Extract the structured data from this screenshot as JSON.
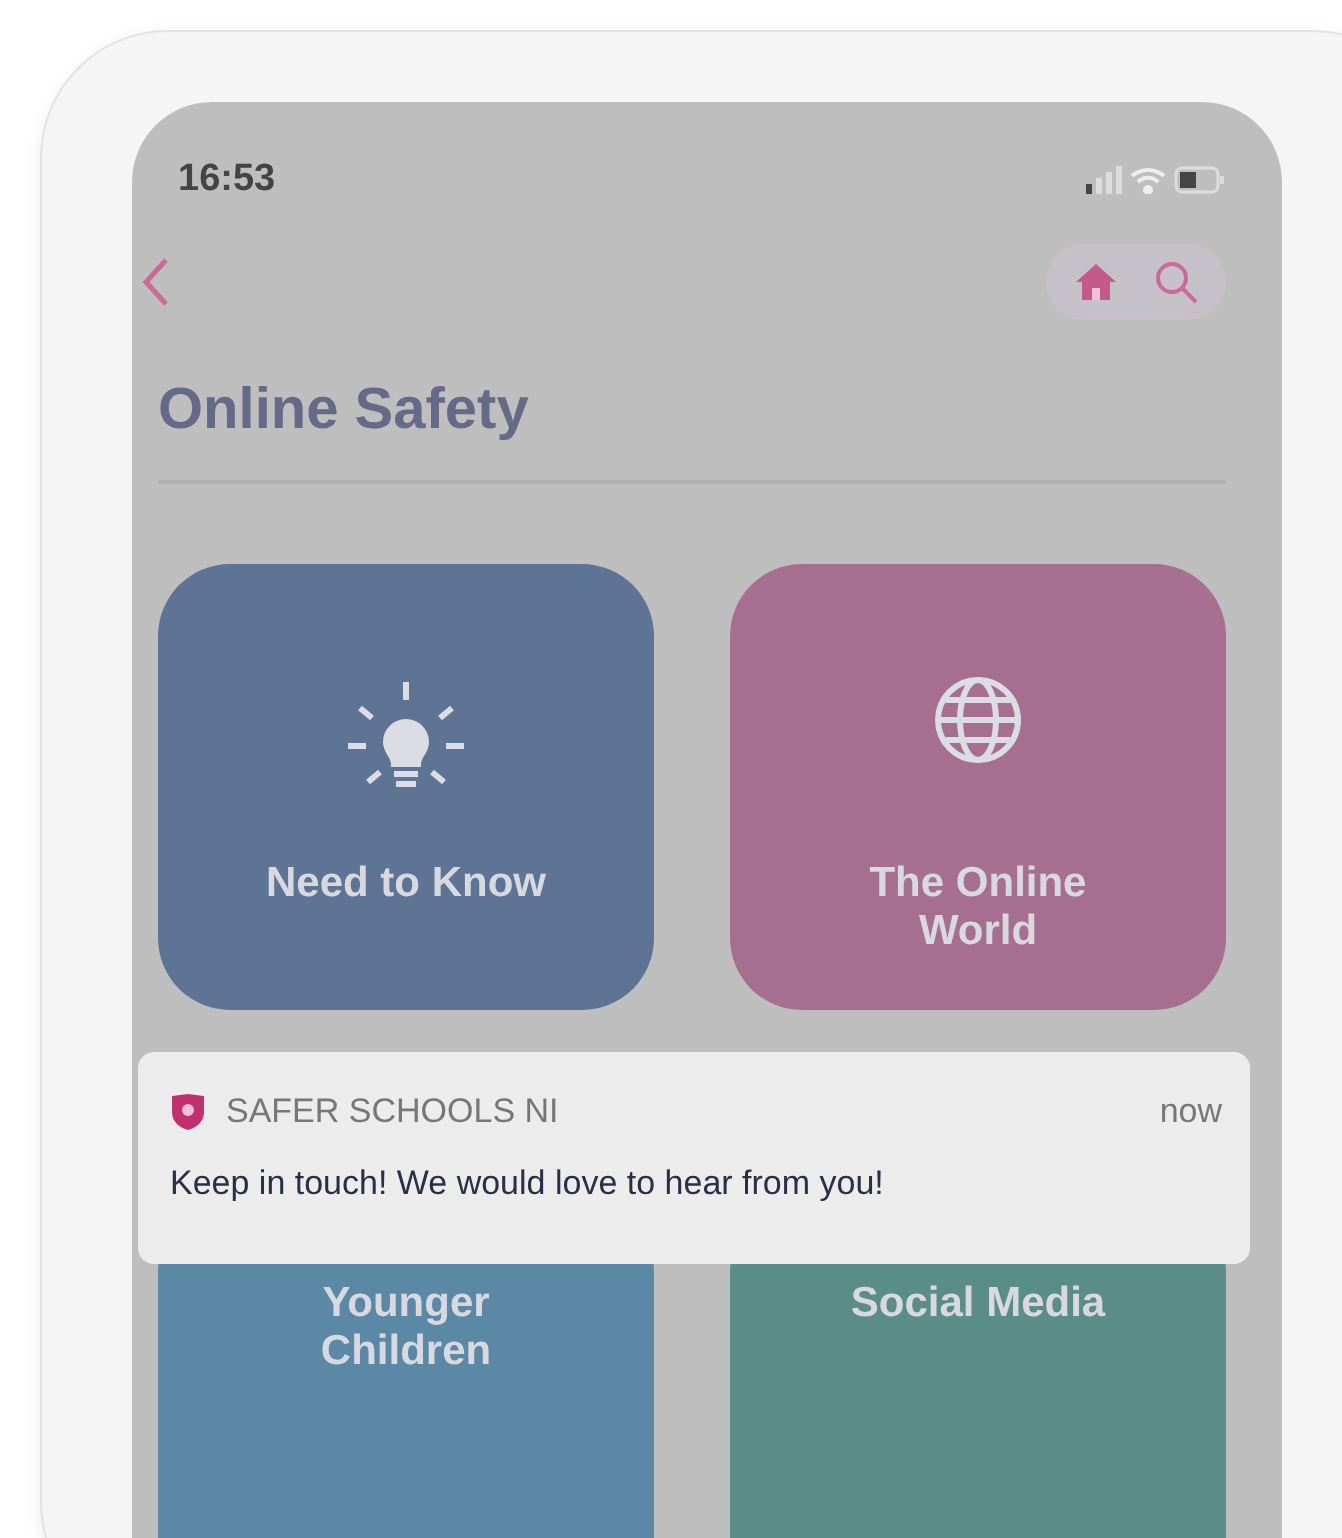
{
  "status_bar": {
    "time": "16:53"
  },
  "title": "Online Safety",
  "tiles": [
    {
      "label": "Need to Know",
      "kind": "bulb",
      "color": "#5e7494"
    },
    {
      "label": "The Online World",
      "kind": "globe",
      "color": "#a66f90"
    },
    {
      "label": "Younger Children",
      "kind": "plain",
      "color": "#5b88a4"
    },
    {
      "label": "Social Media",
      "kind": "plain",
      "color": "#5a8d86"
    }
  ],
  "notification": {
    "app": "SAFER SCHOOLS NI",
    "time": "now",
    "message": "Keep in touch! We would love to hear from you!"
  }
}
